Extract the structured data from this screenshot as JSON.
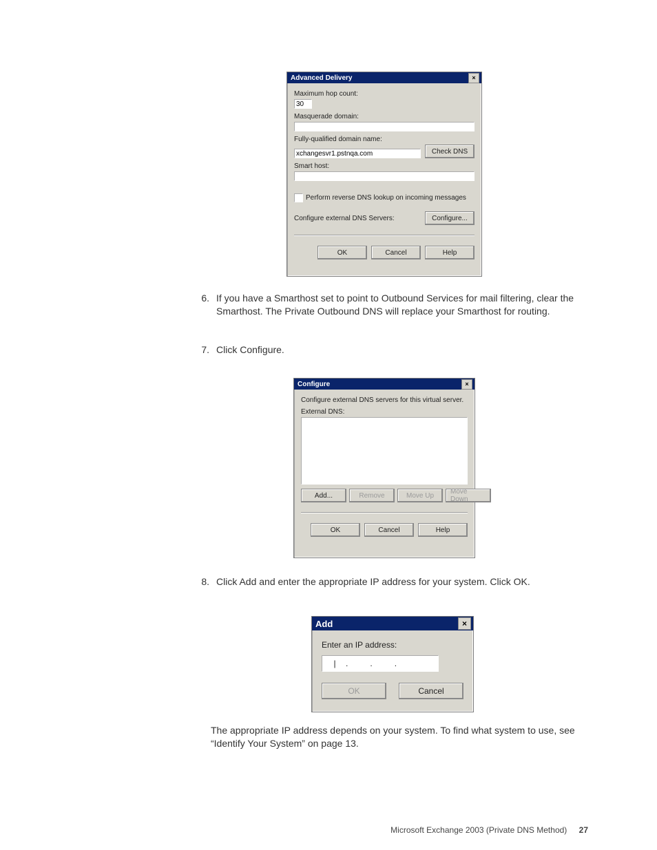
{
  "dialog1": {
    "title": "Advanced Delivery",
    "close": "×",
    "labels": {
      "maxhop": "Maximum hop count:",
      "masq": "Masquerade domain:",
      "fqdn": "Fully-qualified domain name:",
      "smarthost": "Smart host:",
      "revdns": "Perform reverse DNS lookup on incoming messages",
      "extdns": "Configure external DNS Servers:"
    },
    "values": {
      "maxhop": "30",
      "masq": "",
      "fqdn": "xchangesvr1.pstnqa.com",
      "smarthost": ""
    },
    "buttons": {
      "check": "Check DNS",
      "configure": "Configure...",
      "ok": "OK",
      "cancel": "Cancel",
      "help": "Help"
    }
  },
  "step6": {
    "n": "6.",
    "t": "If you have a Smarthost set to point to Outbound Services for mail filtering, clear the Smarthost. The Private Outbound DNS will replace your Smarthost for routing."
  },
  "step7": {
    "n": "7.",
    "t": "Click Configure."
  },
  "dialog2": {
    "title": "Configure",
    "close": "×",
    "desc": "Configure external DNS servers for this virtual server.",
    "listlabel": "External DNS:",
    "buttons": {
      "add": "Add...",
      "remove": "Remove",
      "moveup": "Move Up",
      "movedown": "Move Down",
      "ok": "OK",
      "cancel": "Cancel",
      "help": "Help"
    }
  },
  "step8": {
    "n": "8.",
    "t": "Click Add and enter the appropriate IP address for your system. Click OK."
  },
  "dialog3": {
    "title": "Add",
    "close": "×",
    "label": "Enter an IP address:",
    "buttons": {
      "ok": "OK",
      "cancel": "Cancel"
    }
  },
  "tail": "The appropriate IP address depends on your system. To find what system to use, see “Identify Your System” on page 13.",
  "footer": {
    "text": "Microsoft Exchange 2003 (Private DNS Method)",
    "page": "27"
  }
}
